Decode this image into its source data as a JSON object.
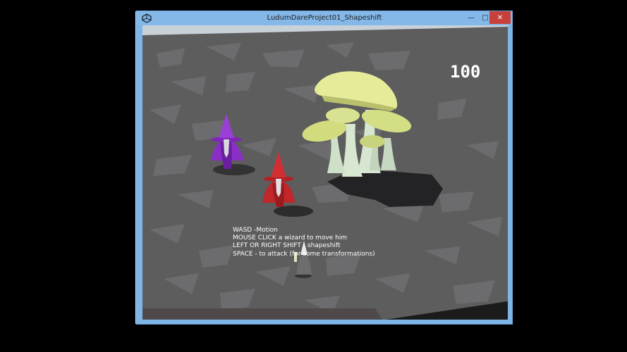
{
  "window": {
    "title": "LudumDareProject01_Shapeshift",
    "icon": "unity-icon",
    "controls": {
      "minimize": "—",
      "maximize": "□",
      "close": "✕"
    }
  },
  "hud": {
    "score": "100"
  },
  "instructions": [
    "WASD -Motion",
    "MOUSE CLICK a wizard to move him",
    "LEFT OR RIGHT SHIFT - shapeshift",
    "SPACE - to attack (for some transformations)"
  ],
  "scene": {
    "wizards": [
      {
        "name": "purple-wizard",
        "color": "#8a2fc6"
      },
      {
        "name": "red-wizard",
        "color": "#c0262a"
      },
      {
        "name": "grey-wizard",
        "color": "#6d6d6d"
      }
    ],
    "mushroom_cap_color": "#e6eb9a",
    "ground_color": "#5e5e5e"
  }
}
